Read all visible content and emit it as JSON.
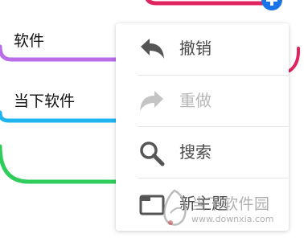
{
  "colors": {
    "branch_top": "#e0245e",
    "branch_software": "#b96be8",
    "branch_current": "#1fb4f0",
    "branch_bottom": "#2ecc5a",
    "add_button": "#1a73e8",
    "menu_text": "#4a4a4a",
    "menu_text_disabled": "#b7b7b7"
  },
  "mindmap": {
    "nodes": [
      {
        "label": "软件"
      },
      {
        "label": "当下软件"
      }
    ],
    "add_button_icon": "plus-icon"
  },
  "context_menu": {
    "items": [
      {
        "label": "撤销",
        "icon": "undo-icon",
        "enabled": true
      },
      {
        "label": "重做",
        "icon": "redo-icon",
        "enabled": false
      },
      {
        "label": "搜索",
        "icon": "search-icon",
        "enabled": true
      },
      {
        "label": "新主题",
        "icon": "new-topic-icon",
        "enabled": true
      }
    ]
  },
  "watermark": {
    "text": "当下软件园",
    "url": "www.downxia.com"
  }
}
